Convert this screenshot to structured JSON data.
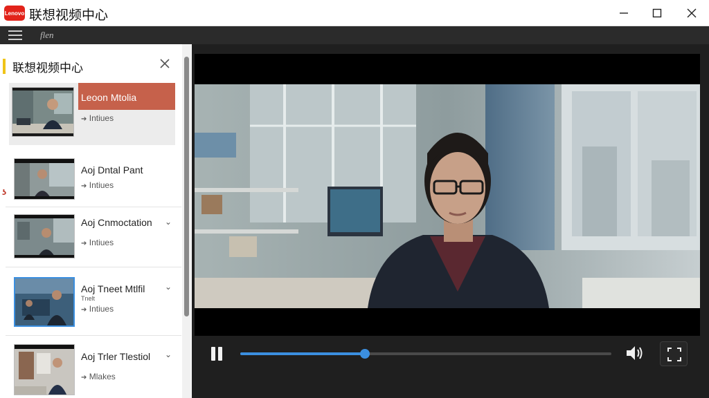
{
  "window": {
    "logo_text": "Lenovo",
    "title": "联想视频中心"
  },
  "menubar": {
    "label": "flen"
  },
  "sidebar": {
    "title": "联想视频中心",
    "red_marker": "ʖ",
    "items": [
      {
        "title": "Leoon Mtolia",
        "subtitle": "Intiues",
        "selected": true
      },
      {
        "title": "Aoj Dntal Pant",
        "subtitle": "Intiues"
      },
      {
        "title": "Aoj Cnmoctation",
        "subtitle": "Intiues"
      },
      {
        "title": "Aoj Tneet Mtlfil",
        "note": "Tnelt",
        "subtitle": "Intiues"
      },
      {
        "title": "Aoj Trler Tlestiol",
        "subtitle": "Mlakes"
      }
    ]
  },
  "player": {
    "progress": 0.335
  },
  "colors": {
    "accent": "#3b8fe0",
    "selected_band": "#c6614b",
    "logo": "#e2231a"
  }
}
